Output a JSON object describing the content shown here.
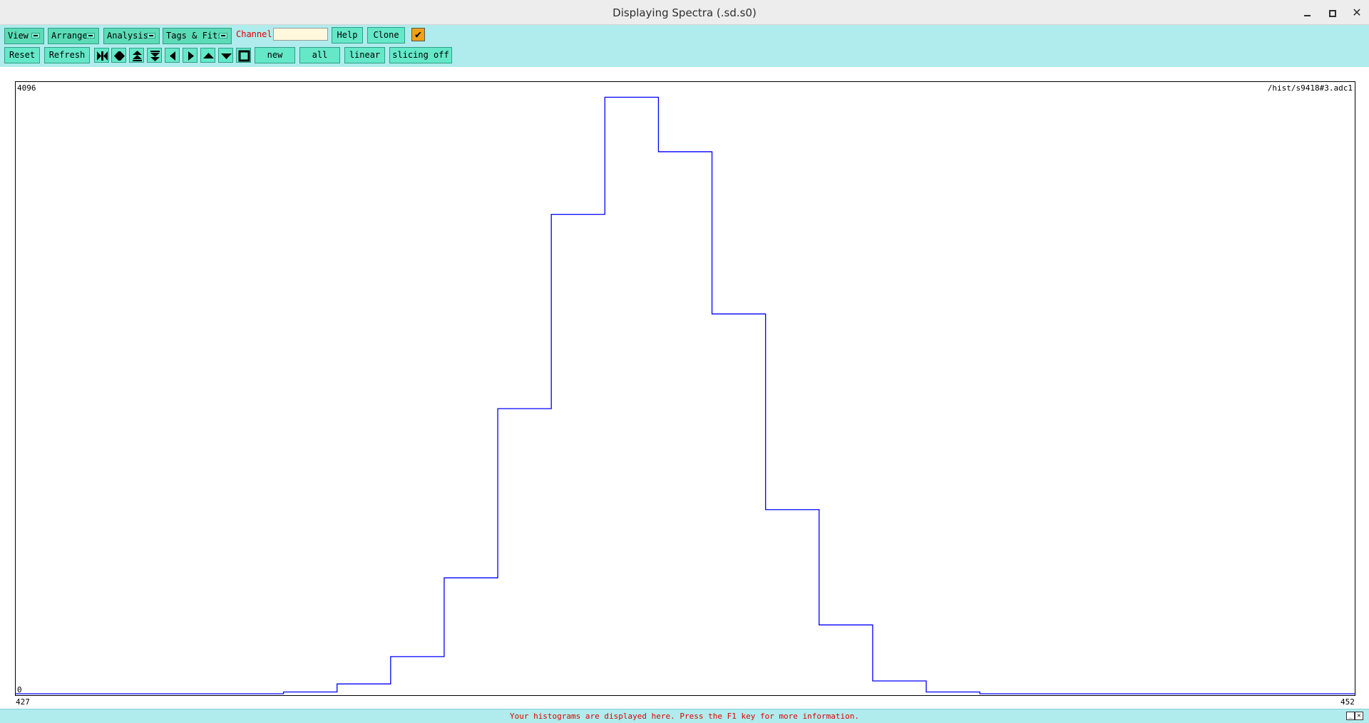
{
  "window": {
    "title": "Displaying Spectra (.sd.s0)"
  },
  "toolbar": {
    "menus": {
      "view": "View",
      "arrange": "Arrange",
      "analysis": "Analysis",
      "tags_fits": "Tags & Fits"
    },
    "channel_label": "Channel:",
    "channel_value": "",
    "help": "Help",
    "clone": "Clone",
    "checkbox_checked": true,
    "reset": "Reset",
    "refresh": "Refresh",
    "new": "new",
    "all": "all",
    "linear": "linear",
    "slicing": "slicing off"
  },
  "spectrum": {
    "name": "/hist/s9418#3.adc1",
    "y_max_label": "4096",
    "y_min_label": "0",
    "x_min_label": "427",
    "x_max_label": "452",
    "line_color": "#0000ff"
  },
  "chart_data": {
    "type": "histogram",
    "x_range": [
      427,
      452
    ],
    "y_range": [
      0,
      4096
    ],
    "bin_width": 1,
    "bins_start": [
      432,
      433,
      434,
      435,
      436,
      437,
      438,
      439,
      440,
      441,
      442,
      443,
      444,
      445,
      446,
      447,
      448
    ],
    "counts": [
      12,
      66,
      249,
      776,
      1909,
      3210,
      3994,
      3629,
      2543,
      1233,
      461,
      86,
      12,
      0,
      0,
      0,
      0
    ]
  },
  "status": {
    "message": "Your histograms are displayed here. Press the F1 key for more information."
  }
}
